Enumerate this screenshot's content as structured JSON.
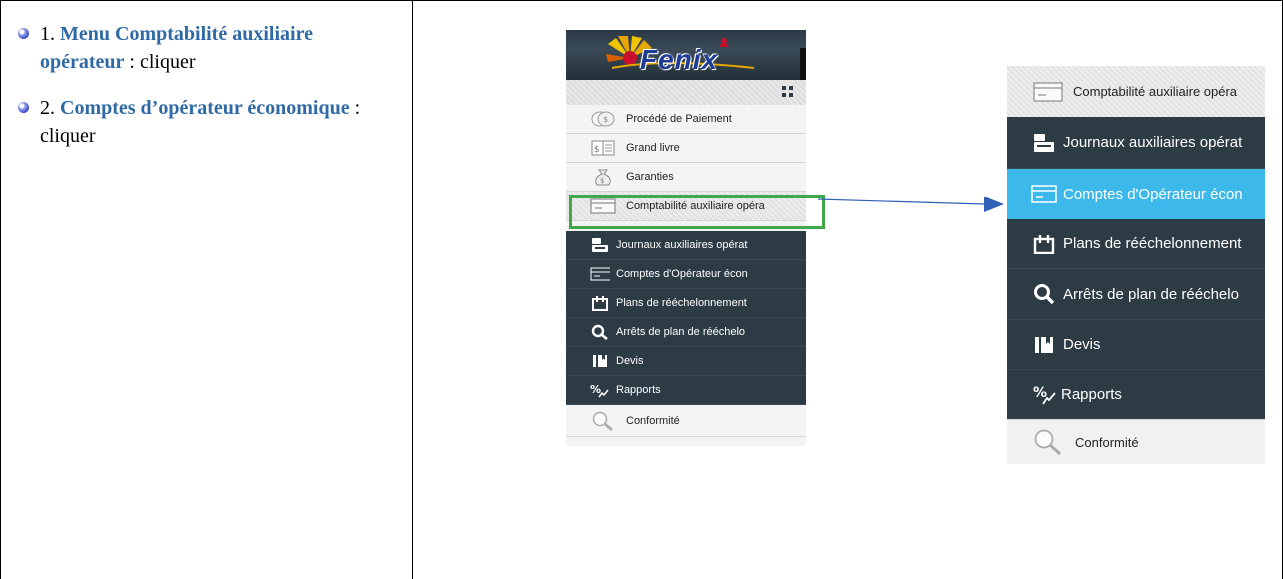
{
  "steps": [
    {
      "number": "1.",
      "link": "Menu Comptabilité auxiliaire opérateur",
      "suffix": " : cliquer"
    },
    {
      "number": "2.",
      "link": "Comptes d’opérateur économique",
      "suffix": " : cliquer"
    }
  ],
  "logo": {
    "text": "Fenix"
  },
  "small_menu": {
    "items": [
      {
        "label": "Procédé de Paiement",
        "icon": "coins-icon",
        "style": "light"
      },
      {
        "label": "Grand livre",
        "icon": "ledger-icon",
        "style": "light"
      },
      {
        "label": "Garanties",
        "icon": "money-bag-icon",
        "style": "light"
      },
      {
        "label": "Comptabilité auxiliaire opéra",
        "icon": "card-icon",
        "style": "light-tex"
      },
      {
        "label": "Journaux auxiliaires opérat",
        "icon": "cash-register-icon",
        "style": "dark"
      },
      {
        "label": "Comptes d'Opérateur écon",
        "icon": "card-icon",
        "style": "dark"
      },
      {
        "label": "Plans de rééchelonnement",
        "icon": "calendar-icon",
        "style": "dark"
      },
      {
        "label": "Arrêts de plan de rééchelo",
        "icon": "search-icon",
        "style": "dark"
      },
      {
        "label": "Devis",
        "icon": "book-icon",
        "style": "dark"
      },
      {
        "label": "Rapports",
        "icon": "percent-chart-icon",
        "style": "dark"
      },
      {
        "label": "Conformité",
        "icon": "magnifier-icon",
        "style": "light"
      }
    ]
  },
  "big_menu": {
    "items": [
      {
        "label": "Comptabilité auxiliaire opéra",
        "icon": "card-icon",
        "style": "light"
      },
      {
        "label": "Journaux auxiliaires opérat",
        "icon": "cash-register-icon",
        "style": "dark"
      },
      {
        "label": "Comptes d'Opérateur écon",
        "icon": "card-icon",
        "style": "active"
      },
      {
        "label": "Plans de rééchelonnement",
        "icon": "calendar-icon",
        "style": "dark"
      },
      {
        "label": "Arrêts de plan de rééchelo",
        "icon": "search-icon",
        "style": "dark"
      },
      {
        "label": "Devis",
        "icon": "book-icon",
        "style": "dark"
      },
      {
        "label": "Rapports",
        "icon": "percent-chart-icon",
        "style": "dark"
      },
      {
        "label": "Conformité",
        "icon": "magnifier-icon",
        "style": "plain"
      }
    ]
  },
  "colors": {
    "link": "#2f6aa6",
    "menu_dark": "#2d3b45",
    "menu_active": "#3db8ea",
    "highlight_box": "#3fa84a",
    "arrow": "#2f62b4"
  }
}
